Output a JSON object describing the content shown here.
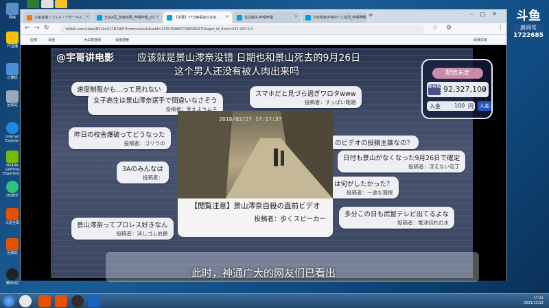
{
  "desktop": {
    "icons": [
      "网络",
      "YY直播",
      "计算机",
      "回收站",
      "Internet Explorer",
      "NVIDIA GeForce Experience",
      "QQ音乐",
      "三星全屏",
      "回收站",
      "腾讯QQ"
    ]
  },
  "browser": {
    "tabs": [
      {
        "label": "斗鱼直播 / ウィル・デザーキル"
      },
      {
        "label": "日本A区_搜索结果_哔哩哔哩_bili"
      },
      {
        "label": "【字幕】77分钟看完日本的..."
      },
      {
        "label": "说文解字-哔哩哔哩"
      },
      {
        "label": "小时候被大呼的个人空间_哔哩哔哩"
      }
    ],
    "url": "bilibili.com/video/BV1k4411N7NW?from=search&seid=17357598877286963270&spm_id_from=333.337.0.0",
    "bookmarks": [
      "应用",
      "百度",
      "大白菜官网",
      "百度搜索"
    ],
    "bookmarks_right": "阅读清单"
  },
  "video": {
    "watermark": "@宇哥讲电影",
    "headline1": "应该就是景山澪奈没错 日期也和景山死去的9月26日",
    "headline2": "这个男人还没有被人肉出来吗",
    "panel": {
      "title": "配信未定",
      "count_label": "観客数",
      "count": "92,327,100",
      "count_unit": "件",
      "enter_label": "入金",
      "enter_value": "100",
      "enter_unit": "円",
      "enter_btn": "入金"
    },
    "clip": {
      "timestamp": "2018/02/2? 1?:1?:3?",
      "caption": "【閲覧注意】景山澪奈自殺の直前ビデオ",
      "author": "投稿者：歩くスピーカー"
    },
    "comments": [
      {
        "text": "速度制限かも...って見れない",
        "by": ""
      },
      {
        "text": "女子高生は景山澪奈選手で間違いなさそう",
        "by": "投稿者：芙えようムネ"
      },
      {
        "text": "スマホだと見づら過ぎワロタwww",
        "by": "投稿者：すっぱい靴箱"
      },
      {
        "text": "昨日の校舎爆破ってどうなった",
        "by": "投稿者：ゴリラの"
      },
      {
        "text": "のビデオの投稿主誰なの？",
        "by": ""
      },
      {
        "text": "日付も景山がなくなった9月26日で確定",
        "by": "投稿者：冴えない包丁"
      },
      {
        "text": "3Aのみんなは",
        "by": "投稿者："
      },
      {
        "text": "は何がしたかった？",
        "by": "投稿者：一途な蓮根"
      },
      {
        "text": "景山澪奈ってプロレス好きなん",
        "by": "投稿者：消しゴム伯爵"
      },
      {
        "text": "多分この日も武智テレビ出てるよな",
        "by": "投稿者：電池切れの氷"
      }
    ],
    "subtitle": "此时，神通广大的网友们已看出"
  },
  "overlay": {
    "brand": "斗鱼",
    "room_label": "房间号",
    "room_id": "1722685"
  },
  "taskbar": {
    "time": "17:31",
    "date": "2021/11/12"
  }
}
